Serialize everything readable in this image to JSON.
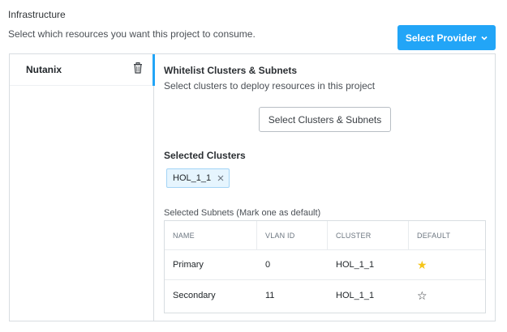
{
  "infrastructure": {
    "title": "Infrastructure",
    "description": "Select which resources you want this project to consume.",
    "provider_button": "Select Provider"
  },
  "providers": [
    {
      "label": "Nutanix",
      "active": true
    }
  ],
  "whitelist": {
    "title": "Whitelist Clusters & Subnets",
    "description": "Select clusters to deploy resources in this project",
    "select_button": "Select Clusters & Subnets",
    "selected_clusters_title": "Selected Clusters",
    "clusters": [
      "HOL_1_1"
    ],
    "subnets_title": "Selected Subnets (Mark one as default)",
    "columns": [
      "NAME",
      "VLAN ID",
      "CLUSTER",
      "DEFAULT"
    ],
    "rows": [
      {
        "name": "Primary",
        "vlan": "0",
        "cluster": "HOL_1_1",
        "default": true
      },
      {
        "name": "Secondary",
        "vlan": "11",
        "cluster": "HOL_1_1",
        "default": false
      }
    ]
  },
  "icons": {
    "chevron": "chevron-down-icon",
    "trash": "trash-icon",
    "remove": "close-icon",
    "star_filled": "star-filled-icon",
    "star_empty": "star-outline-icon"
  },
  "colors": {
    "accent": "#22a5f7",
    "tag_bg": "#e6f5fe",
    "star": "#f5c518"
  }
}
